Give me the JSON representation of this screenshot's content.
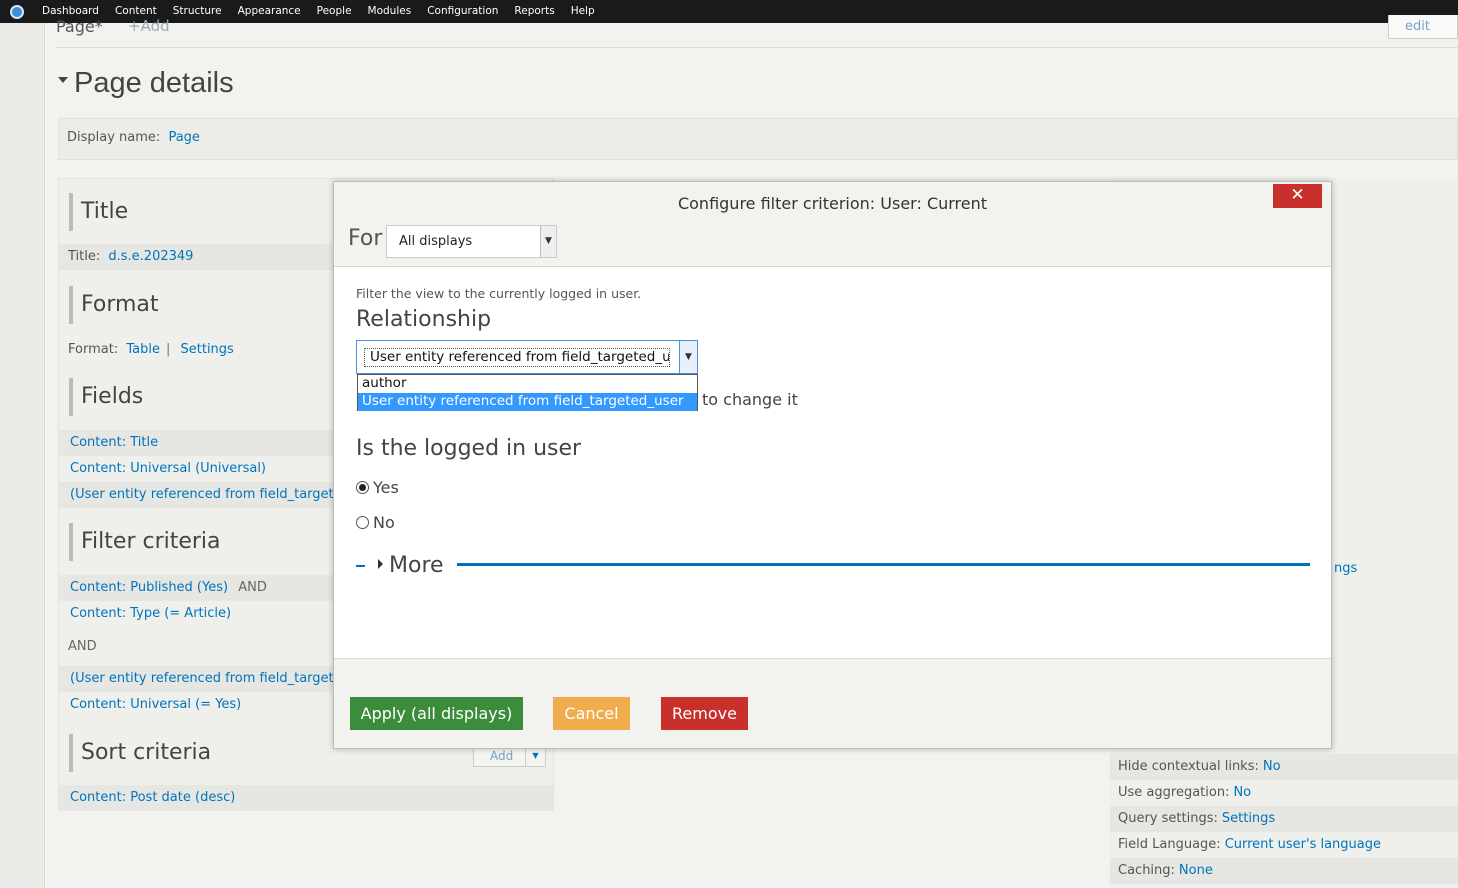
{
  "toolbar": {
    "items": [
      "Dashboard",
      "Content",
      "Structure",
      "Appearance",
      "People",
      "Modules",
      "Configuration",
      "Reports",
      "Help"
    ]
  },
  "tabs": {
    "page": "Page*",
    "add": "+Add",
    "edit_view": "edit view"
  },
  "page_details": {
    "heading": "Page details",
    "display_name_label": "Display name:",
    "display_name_value": "Page"
  },
  "sections": {
    "title": {
      "heading": "Title",
      "label": "Title:",
      "value": "d.s.e.202349"
    },
    "format": {
      "heading": "Format",
      "label": "Format:",
      "value": "Table",
      "settings": "Settings"
    },
    "fields": {
      "heading": "Fields",
      "items": [
        "Content: Title",
        "Content: Universal (Universal)",
        "(User entity referenced from field_targeted_"
      ]
    },
    "filter": {
      "heading": "Filter criteria",
      "item1": "Content: Published (Yes)",
      "and1": "AND",
      "item2": "Content: Type (= Article)",
      "and2": "AND",
      "item3": "(User entity referenced from field_targeted_",
      "item4": "Content: Universal (= Yes)"
    },
    "sort": {
      "heading": "Sort criteria",
      "add": "Add",
      "item": "Content: Post date (desc)"
    }
  },
  "right_column": {
    "partial": "ngs",
    "rows": [
      {
        "label": "Hide contextual links:",
        "value": "No"
      },
      {
        "label": "Use aggregation:",
        "value": "No"
      },
      {
        "label": "Query settings:",
        "value": "Settings"
      },
      {
        "label": "Field Language:",
        "value": "Current user's language"
      },
      {
        "label": "Caching:",
        "value": "None"
      }
    ]
  },
  "modal": {
    "title": "Configure filter criterion: User: Current",
    "close": "✕",
    "for_label": "For",
    "for_value": "All displays",
    "description": "Filter the view to the currently logged in user.",
    "relationship_label": "Relationship",
    "relationship_value": "User entity referenced from field_targeted_user",
    "dropdown_options": [
      "author",
      "User entity referenced from field_targeted_user"
    ],
    "change_text": "to change it",
    "logged_label": "Is the logged in user",
    "radio_yes": "Yes",
    "radio_no": "No",
    "more": "More",
    "buttons": {
      "apply": "Apply (all displays)",
      "cancel": "Cancel",
      "remove": "Remove"
    }
  },
  "colors": {
    "toolbar_bg": "#1a1a1a",
    "link": "#0074bd",
    "apply": "#3b8c3b",
    "cancel": "#f0ad4e",
    "remove": "#c9302c",
    "dropdown_selected": "#3399ff"
  }
}
